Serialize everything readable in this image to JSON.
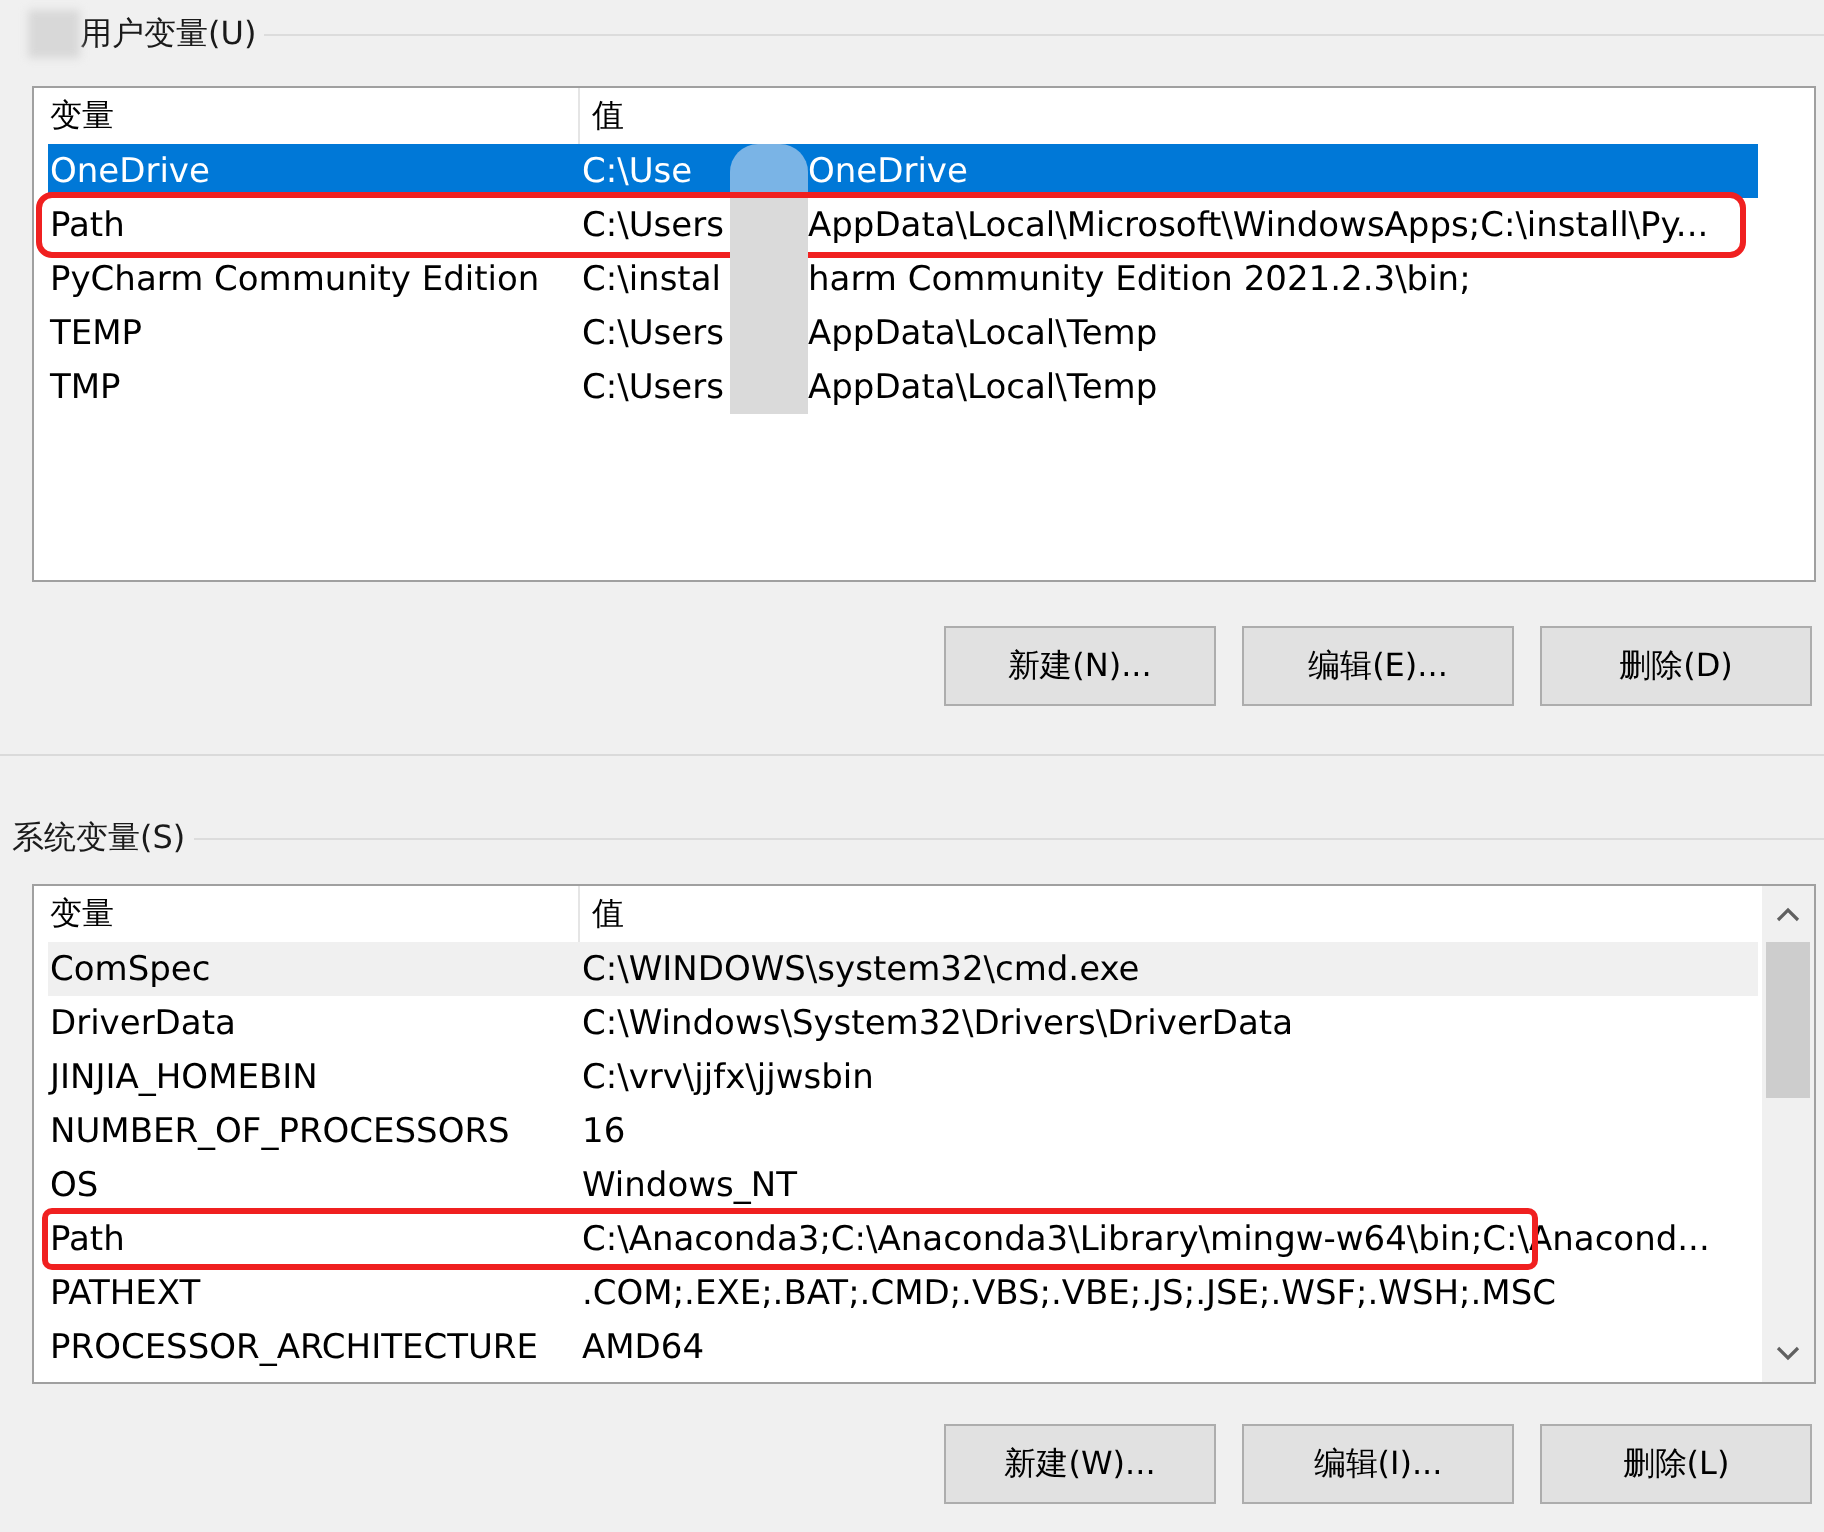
{
  "user_vars": {
    "title": "用户变量(U)",
    "title_redacted": true,
    "columns": [
      "变量",
      "值"
    ],
    "rows": [
      {
        "name": "OneDrive",
        "value_parts": [
          "C:\\Use",
          "OneDrive"
        ],
        "selected": true,
        "marked": false
      },
      {
        "name": "Path",
        "value_parts": [
          "C:\\Users",
          "AppData\\Local\\Microsoft\\WindowsApps;C:\\install\\Py..."
        ],
        "selected": false,
        "marked": true
      },
      {
        "name": "PyCharm Community Edition",
        "value_parts": [
          "C:\\instal",
          "harm Community Edition 2021.2.3\\bin;"
        ],
        "selected": false,
        "marked": false
      },
      {
        "name": "TEMP",
        "value_parts": [
          "C:\\Users",
          "AppData\\Local\\Temp"
        ],
        "selected": false,
        "marked": false
      },
      {
        "name": "TMP",
        "value_parts": [
          "C:\\Users",
          "AppData\\Local\\Temp"
        ],
        "selected": false,
        "marked": false
      }
    ],
    "buttons": [
      "新建(N)...",
      "编辑(E)...",
      "删除(D)"
    ]
  },
  "system_vars": {
    "title": "系统变量(S)",
    "columns": [
      "变量",
      "值"
    ],
    "rows": [
      {
        "name": "ComSpec",
        "value": "C:\\WINDOWS\\system32\\cmd.exe",
        "selected": false,
        "hovered": true,
        "marked": false
      },
      {
        "name": "DriverData",
        "value": "C:\\Windows\\System32\\Drivers\\DriverData",
        "selected": false,
        "hovered": false,
        "marked": false
      },
      {
        "name": "JINJIA_HOMEBIN",
        "value": "C:\\vrv\\jjfx\\jjwsbin",
        "selected": false,
        "hovered": false,
        "marked": false
      },
      {
        "name": "NUMBER_OF_PROCESSORS",
        "value": "16",
        "selected": false,
        "hovered": false,
        "marked": false
      },
      {
        "name": "OS",
        "value": "Windows_NT",
        "selected": false,
        "hovered": false,
        "marked": false
      },
      {
        "name": "Path",
        "value": "C:\\Anaconda3;C:\\Anaconda3\\Library\\mingw-w64\\bin;C:\\Anacond...",
        "selected": false,
        "hovered": false,
        "marked": true
      },
      {
        "name": "PATHEXT",
        "value": ".COM;.EXE;.BAT;.CMD;.VBS;.VBE;.JS;.JSE;.WSF;.WSH;.MSC",
        "selected": false,
        "hovered": false,
        "marked": false
      },
      {
        "name": "PROCESSOR_ARCHITECTURE",
        "value": "AMD64",
        "selected": false,
        "hovered": false,
        "marked": false
      }
    ],
    "buttons": [
      "新建(W)...",
      "编辑(I)...",
      "删除(L)"
    ]
  }
}
